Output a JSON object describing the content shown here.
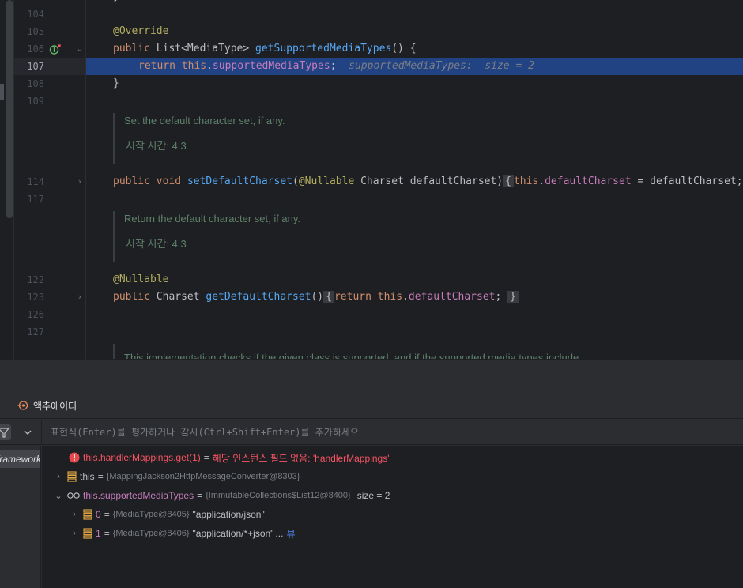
{
  "editor": {
    "lines": [
      {
        "num": "104"
      },
      {
        "num": "105"
      },
      {
        "num": "106"
      },
      {
        "num": "107"
      },
      {
        "num": "108"
      },
      {
        "num": "109"
      },
      {
        "num": "114"
      },
      {
        "num": "117"
      },
      {
        "num": "122"
      },
      {
        "num": "123"
      },
      {
        "num": "126"
      },
      {
        "num": "127"
      }
    ],
    "code": {
      "override": "@Override",
      "l106_kw": "public",
      "l106_type": " List<MediaType> ",
      "l106_fn": "getSupportedMediaTypes",
      "l106_rest": "() {",
      "l107_kw": "return",
      "l107_this": "this",
      "l107_dot": ".",
      "l107_field": "supportedMediaTypes",
      "l107_end": ";",
      "l107_hint": "  supportedMediaTypes:  size = 2",
      "l108": "}",
      "l114_kw1": "public",
      "l114_kw2": "void",
      "l114_fn": "setDefaultCharset",
      "l114_paren": "(",
      "l114_ann": "@Nullable",
      "l114_params": " Charset defaultCharset)",
      "l114_fold": "{",
      "l114_this": "this",
      "l114_dot": ".",
      "l114_field": "defaultCharset",
      "l114_rest": " = defaultCharset;",
      "nullable": "@Nullable",
      "l123_kw": "public",
      "l123_type": " Charset ",
      "l123_fn": "getDefaultCharset",
      "l123_paren": "()",
      "l123_fold_open": "{",
      "l123_ret": "return",
      "l123_this": "this",
      "l123_dot": ".",
      "l123_field": "defaultCharset",
      "l123_semi": ";",
      "l123_fold_close": "}"
    },
    "docs": [
      {
        "text": "Set the default character set, if any.",
        "since": "시작 시간: 4.3"
      },
      {
        "text": "Return the default character set, if any.",
        "since": "시작 시간: 4.3"
      },
      {
        "text": "This implementation checks if the given class is supported, and if the supported media types include"
      }
    ]
  },
  "debug": {
    "tab_label": "액추에이터",
    "eval_placeholder": "표현식(Enter)를 평가하거나 감시(Ctrl+Shift+Enter)를 추가하세요",
    "frame_label": "framework",
    "vars": [
      {
        "name": "this.handlerMappings.get(1)",
        "eq": "=",
        "error": "해당 인스턴스 필드 없음: 'handlerMappings'"
      },
      {
        "name": "this",
        "eq": "=",
        "type": "{MappingJackson2HttpMessageConverter@8303}"
      },
      {
        "name": "this.supportedMediaTypes",
        "eq": "=",
        "type": "{ImmutableCollections$List12@8400}",
        "extra": "size = 2"
      },
      {
        "name": "0",
        "eq": "=",
        "type": "{MediaType@8405}",
        "value": "\"application/json\""
      },
      {
        "name": "1",
        "eq": "=",
        "type": "{MediaType@8406}",
        "value": "\"application/*+json\"",
        "ellipsis": "...",
        "link": "뷰"
      }
    ]
  },
  "colors": {
    "editor_bg": "#1e1f22",
    "current_line": "#214283",
    "keyword": "#cf8e6d",
    "annotation": "#b3ae60",
    "function": "#56a8f5",
    "field": "#c77dbb",
    "doc": "#5f826b",
    "error": "#f75464",
    "link": "#548af7"
  }
}
